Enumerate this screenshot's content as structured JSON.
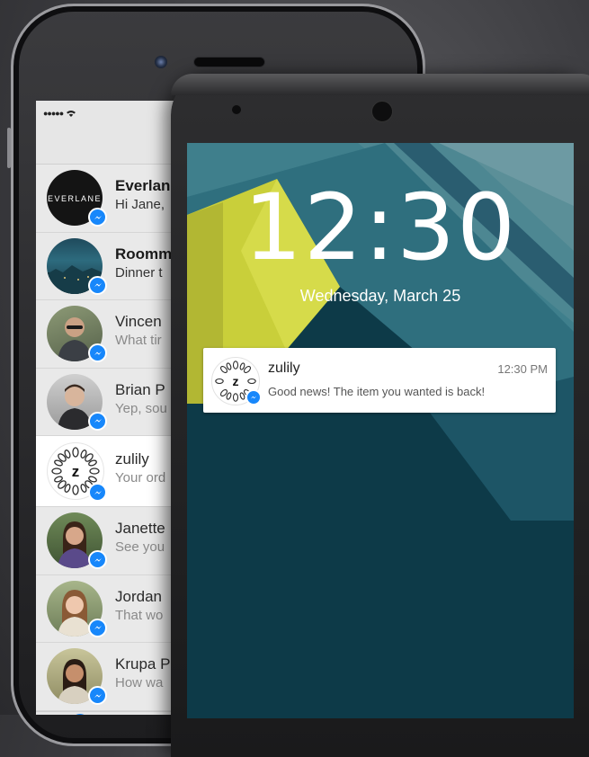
{
  "iphone": {
    "chats": [
      {
        "name": "Everlane",
        "snippet": "Hi Jane,",
        "avatar": "everlane-logo",
        "avatar_text": "EVERLANE",
        "bold": true
      },
      {
        "name": "Roomm",
        "snippet": "Dinner t",
        "avatar": "landscape-photo",
        "bold": true
      },
      {
        "name": "Vincen",
        "snippet": "What tir",
        "avatar": "person-photo",
        "bold": false
      },
      {
        "name": "Brian P",
        "snippet": "Yep, sou",
        "avatar": "person-photo",
        "bold": false
      },
      {
        "name": "zulily",
        "snippet": "Your ord",
        "avatar": "zulily-logo",
        "avatar_text": "z",
        "bold": false
      },
      {
        "name": "Janette",
        "snippet": "See you",
        "avatar": "person-photo",
        "bold": false
      },
      {
        "name": "Jordan",
        "snippet": "That wo",
        "avatar": "person-photo",
        "bold": false
      },
      {
        "name": "Krupa P",
        "snippet": "How wa",
        "avatar": "person-photo",
        "bold": false
      }
    ]
  },
  "android": {
    "time": "12:30",
    "date": "Wednesday, March 25",
    "notification": {
      "title": "zulily",
      "time": "12:30 PM",
      "body": "Good news! The item you wanted is back!",
      "avatar_text": "z"
    }
  },
  "colors": {
    "messenger_blue": "#1787fb",
    "wallpaper_teal": "#2a6b7b",
    "wallpaper_dark": "#0d3a48",
    "wallpaper_yellow": "#c9cf3a"
  }
}
